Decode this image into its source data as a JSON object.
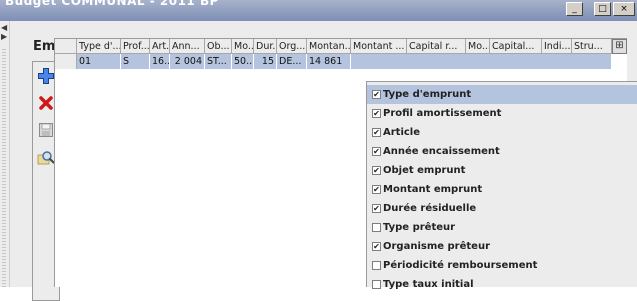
{
  "window": {
    "title": "Budget COMMUNAL - 2011 BP",
    "buttons": [
      "_",
      "□",
      "×"
    ]
  },
  "panel": {
    "title": "Emprunts"
  },
  "toolbar": {
    "add_icon": "plus-icon",
    "delete_icon": "cross-icon",
    "save_icon": "floppy-disk-icon",
    "search_icon": "magnifier-icon"
  },
  "table": {
    "headers": [
      "Type d'...",
      "Prof...",
      "Art...",
      "Ann...",
      "Ob...",
      "Mo...",
      "Dur...",
      "Org...",
      "Montan...",
      "Montant ...",
      "Capital r...",
      "Mo...",
      "Capital...",
      "Indi...",
      "Stru..."
    ],
    "rows": [
      [
        "01",
        "S",
        "16...",
        "2 004",
        "ST...",
        "50...",
        "15",
        "DE...",
        "14 861",
        "",
        "",
        "",
        "",
        "",
        ""
      ]
    ],
    "column_chooser_icon": "column-chooser-icon"
  },
  "column_menu": {
    "items": [
      {
        "label": "Type d'emprunt",
        "checked": true,
        "highlighted": true
      },
      {
        "label": "Profil amortissement",
        "checked": true
      },
      {
        "label": "Article",
        "checked": true
      },
      {
        "label": "Année encaissement",
        "checked": true
      },
      {
        "label": "Objet emprunt",
        "checked": true
      },
      {
        "label": "Montant emprunt",
        "checked": true
      },
      {
        "label": "Durée résiduelle",
        "checked": true
      },
      {
        "label": "Type prêteur",
        "checked": false
      },
      {
        "label": "Organisme prêteur",
        "checked": true
      },
      {
        "label": "Périodicité remboursement",
        "checked": false
      },
      {
        "label": "Type taux initial",
        "checked": false
      }
    ]
  },
  "colors": {
    "selection": "#b4c4de",
    "panel_bg": "#ececec",
    "titlebar": "#8d9cbd"
  }
}
